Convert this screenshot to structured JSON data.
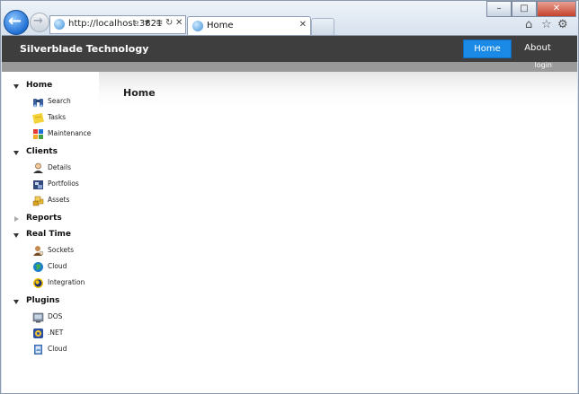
{
  "browser": {
    "url": "http://localhost:3821",
    "tab_title": "Home"
  },
  "app": {
    "brand": "Silverblade Technology",
    "nav": [
      {
        "label": "Home",
        "active": true
      },
      {
        "label": "About",
        "active": false
      }
    ],
    "login_label": "login",
    "page_title": "Home"
  },
  "sidebar": {
    "groups": [
      {
        "label": "Home",
        "expanded": true,
        "items": [
          {
            "label": "Search",
            "icon": "binoculars-icon"
          },
          {
            "label": "Tasks",
            "icon": "sticky-note-icon"
          },
          {
            "label": "Maintenance",
            "icon": "tiles-icon"
          }
        ]
      },
      {
        "label": "Clients",
        "expanded": true,
        "items": [
          {
            "label": "Details",
            "icon": "person-icon"
          },
          {
            "label": "Portfolios",
            "icon": "portfolio-icon"
          },
          {
            "label": "Assets",
            "icon": "gold-bars-icon"
          }
        ]
      },
      {
        "label": "Reports",
        "expanded": false,
        "items": []
      },
      {
        "label": "Real Time",
        "expanded": true,
        "items": [
          {
            "label": "Sockets",
            "icon": "socket-person-icon"
          },
          {
            "label": "Cloud",
            "icon": "globe-icon"
          },
          {
            "label": "Integration",
            "icon": "eclipse-icon"
          }
        ]
      },
      {
        "label": "Plugins",
        "expanded": true,
        "items": [
          {
            "label": "DOS",
            "icon": "dos-icon"
          },
          {
            "label": ".NET",
            "icon": "dotnet-icon"
          },
          {
            "label": "Cloud",
            "icon": "cloud-book-icon"
          }
        ]
      }
    ]
  },
  "colors": {
    "topbar": "#3e3e3e",
    "active_nav": "#1a8ae6",
    "subbar": "#9a9a9a"
  }
}
